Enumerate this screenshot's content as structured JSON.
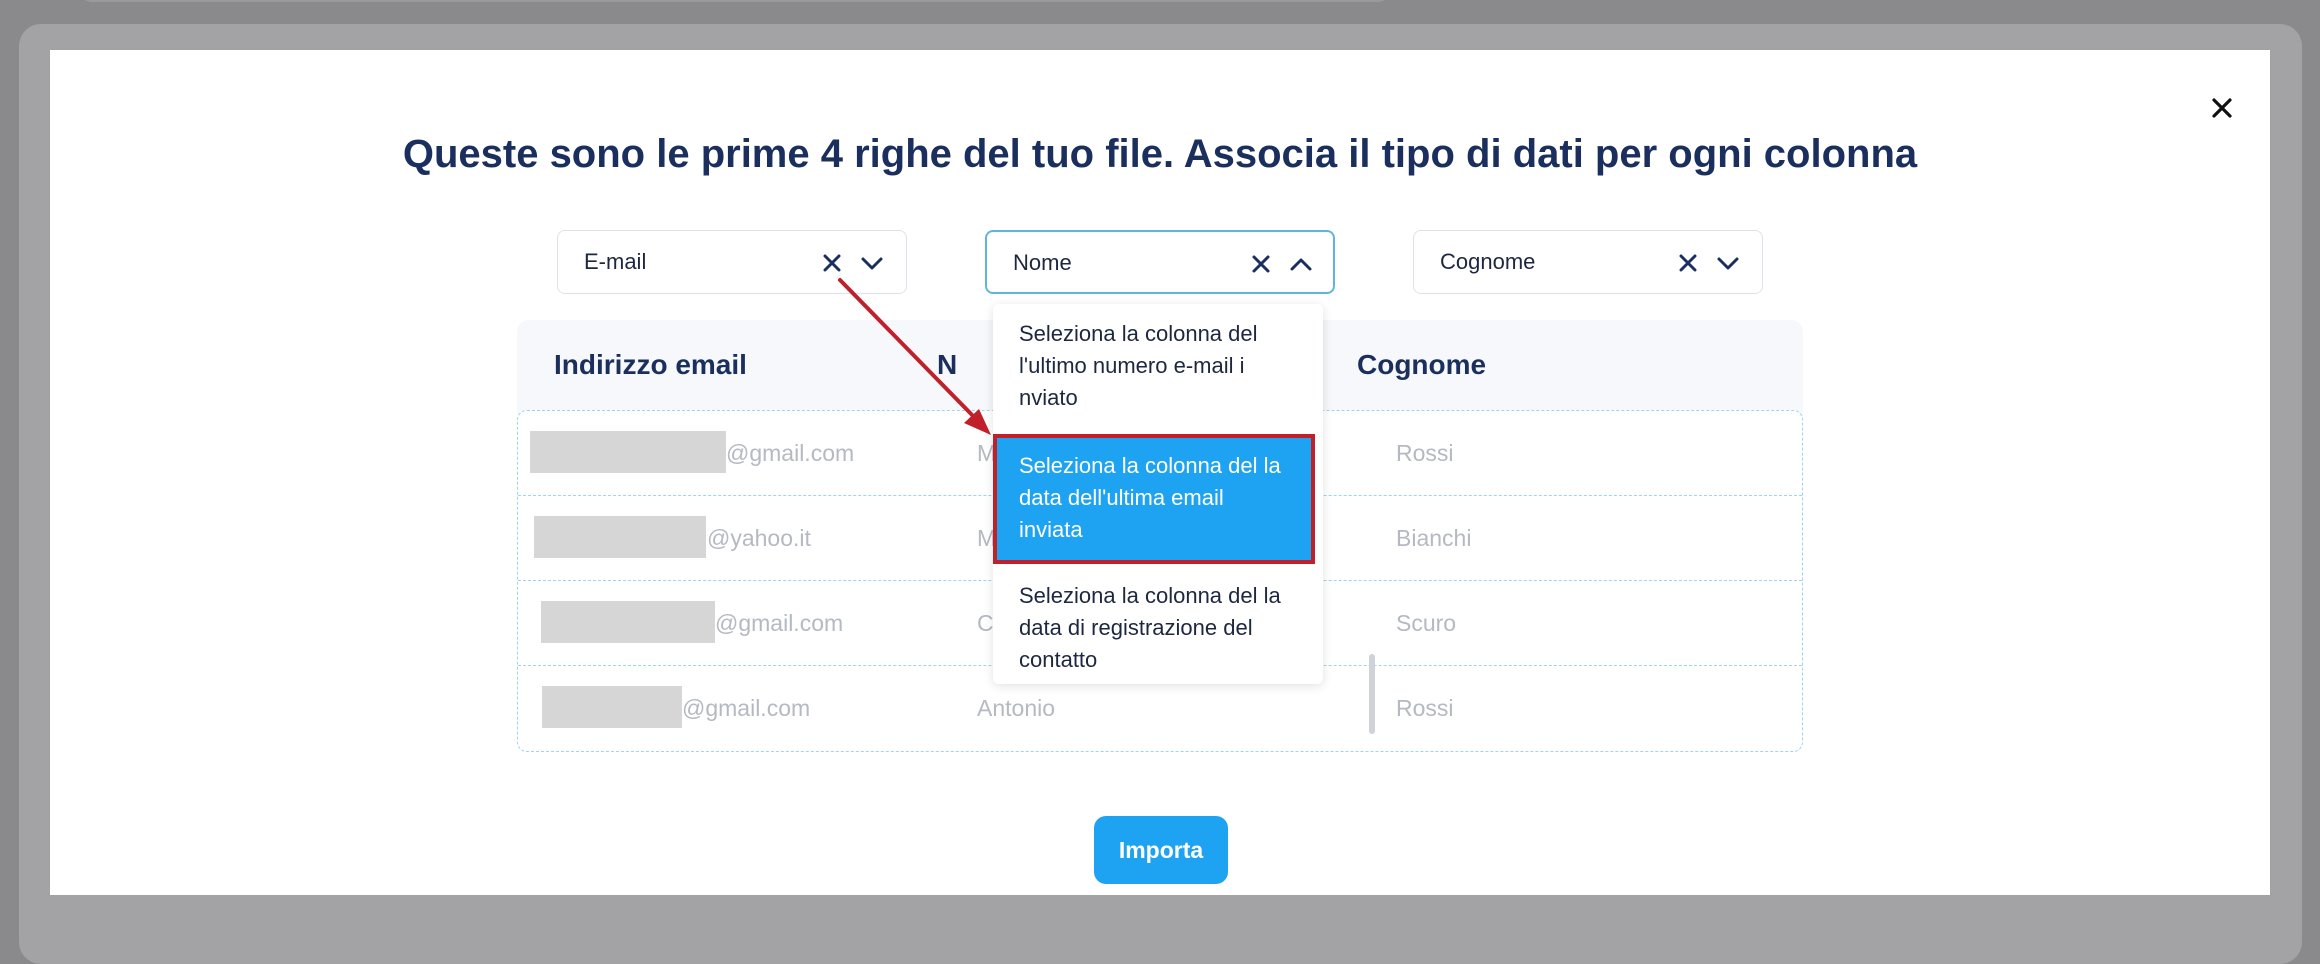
{
  "modal": {
    "title": "Queste sono le prime 4 righe del tuo file. Associa il tipo di dati per ogni colonna"
  },
  "mappers": [
    {
      "value": "E-mail",
      "state": "closed"
    },
    {
      "value": "Nome",
      "state": "open"
    },
    {
      "value": "Cognome",
      "state": "closed"
    }
  ],
  "table": {
    "headers": [
      "Indirizzo email",
      "N",
      "Cognome"
    ],
    "rows": [
      {
        "email": "@gmail.com",
        "nome": "M",
        "cognome": "Rossi"
      },
      {
        "email": "@yahoo.it",
        "nome": "M",
        "cognome": "Bianchi"
      },
      {
        "email": "@gmail.com",
        "nome": "C",
        "cognome": "Scuro"
      },
      {
        "email": "@gmail.com",
        "nome": "Antonio",
        "cognome": "Rossi"
      }
    ]
  },
  "dropdown": {
    "options": [
      {
        "label": "Seleziona la colonna del l'ultimo numero e-mail i nviato"
      },
      {
        "label": "Seleziona la colonna del la data dell'ultima email inviata",
        "selected": true
      },
      {
        "label": "Seleziona la colonna del la data di registrazione del contatto"
      }
    ]
  },
  "actions": {
    "import_label": "Importa"
  },
  "colors": {
    "title": "#1b2f5e",
    "accent": "#1ea3f3",
    "highlight_border": "#c0202a",
    "annotation_arrow": "#c0202a"
  },
  "icons": {
    "close": "close-icon",
    "clear": "clear-x-icon",
    "chevron_down": "chevron-down-icon",
    "chevron_up": "chevron-up-icon",
    "annotation_arrow": "arrow-annotation-icon"
  }
}
